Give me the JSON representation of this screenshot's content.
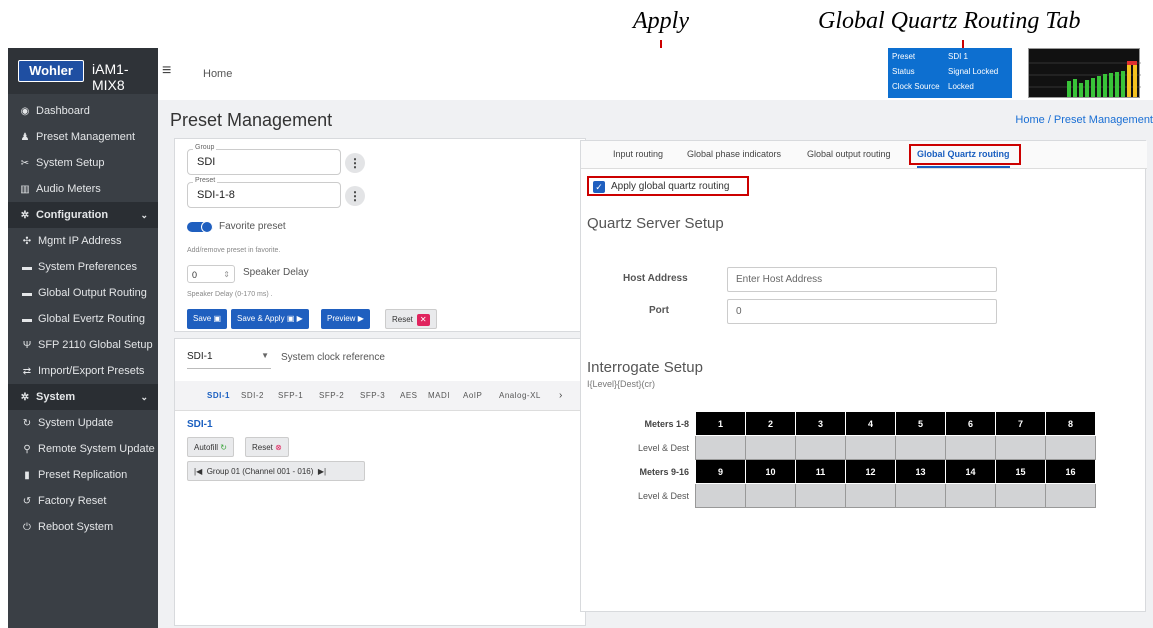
{
  "annotations": {
    "apply": "Apply",
    "quartz_tab": "Global Quartz Routing Tab"
  },
  "brand": {
    "logo": "Wohler",
    "model": "iAM1-MIX8"
  },
  "sidebar": {
    "items": [
      {
        "label": "Dashboard",
        "icon": "dashboard-icon",
        "glyph": "◉"
      },
      {
        "label": "Preset Management",
        "icon": "users-icon",
        "glyph": "♟"
      },
      {
        "label": "System Setup",
        "icon": "tools-icon",
        "glyph": "✂"
      },
      {
        "label": "Audio Meters",
        "icon": "chart-icon",
        "glyph": "▥"
      },
      {
        "label": "Configuration",
        "icon": "gear-icon",
        "glyph": "✲",
        "header": true
      },
      {
        "label": "Mgmt IP Address",
        "icon": "network-icon",
        "glyph": "✣",
        "sub": true
      },
      {
        "label": "System Preferences",
        "icon": "card-icon",
        "glyph": "▬",
        "sub": true
      },
      {
        "label": "Global Output Routing",
        "icon": "card-icon",
        "glyph": "▬",
        "sub": true
      },
      {
        "label": "Global Evertz Routing",
        "icon": "card-icon",
        "glyph": "▬",
        "sub": true
      },
      {
        "label": "SFP 2110 Global Setup",
        "icon": "plug-icon",
        "glyph": "Ψ",
        "sub": true
      },
      {
        "label": "Import/Export Presets",
        "icon": "exchange-icon",
        "glyph": "⇄",
        "sub": true
      },
      {
        "label": "System",
        "icon": "gears-icon",
        "glyph": "✲",
        "header": true
      },
      {
        "label": "System Update",
        "icon": "sync-icon",
        "glyph": "↻",
        "sub": true
      },
      {
        "label": "Remote System Update",
        "icon": "satellite-icon",
        "glyph": "⚲",
        "sub": true
      },
      {
        "label": "Preset Replication",
        "icon": "copy-icon",
        "glyph": "▮",
        "sub": true
      },
      {
        "label": "Factory Reset",
        "icon": "undo-icon",
        "glyph": "↺",
        "sub": true
      },
      {
        "label": "Reboot System",
        "icon": "power-icon",
        "glyph": "⏻",
        "sub": true
      }
    ]
  },
  "topbar": {
    "home": "Home"
  },
  "status": {
    "rows": [
      [
        "Preset",
        "SDI 1"
      ],
      [
        "Status",
        "Signal Locked"
      ],
      [
        "Clock Source",
        "Locked"
      ]
    ]
  },
  "page": {
    "title": "Preset Management",
    "breadcrumb": "Home / Preset Management"
  },
  "preset_card": {
    "group_label": "Group",
    "group_value": "SDI",
    "preset_label": "Preset",
    "preset_value": "SDI-1-8",
    "favorite": "Favorite preset",
    "favorite_note": "Add/remove preset in favorite.",
    "delay_value": "0",
    "delay_label": "Speaker Delay",
    "delay_note": "Speaker Delay (0-170 ms) .",
    "save": "Save",
    "save_apply": "Save & Apply",
    "preview": "Preview",
    "reset": "Reset"
  },
  "clock": {
    "value": "SDI-1",
    "label": "System clock reference"
  },
  "input_tabs": [
    "SDI-1",
    "SDI-2",
    "SFP-1",
    "SFP-2",
    "SFP-3",
    "AES",
    "MADI",
    "AoIP",
    "Analog-XL"
  ],
  "input_panel": {
    "title": "SDI-1",
    "autofill": "Autofill",
    "reset": "Reset",
    "group": "Group 01 (Channel 001 - 016)"
  },
  "right_tabs": [
    "Input routing",
    "Global phase indicators",
    "Global output routing",
    "Global Quartz routing"
  ],
  "apply": {
    "label": "Apply global quartz routing",
    "checked": true
  },
  "quartz": {
    "heading": "Quartz Server Setup",
    "host_label": "Host Address",
    "host_placeholder": "Enter Host Address",
    "port_label": "Port",
    "port_value": "0"
  },
  "interrogate": {
    "heading": "Interrogate Setup",
    "format": "I{Level}{Dest}(cr)",
    "row1_label": "Meters 1-8",
    "row1": [
      "1",
      "2",
      "3",
      "4",
      "5",
      "6",
      "7",
      "8"
    ],
    "row2_label": "Level & Dest",
    "row3_label": "Meters 9-16",
    "row3": [
      "9",
      "10",
      "11",
      "12",
      "13",
      "14",
      "15",
      "16"
    ],
    "row4_label": "Level & Dest"
  }
}
